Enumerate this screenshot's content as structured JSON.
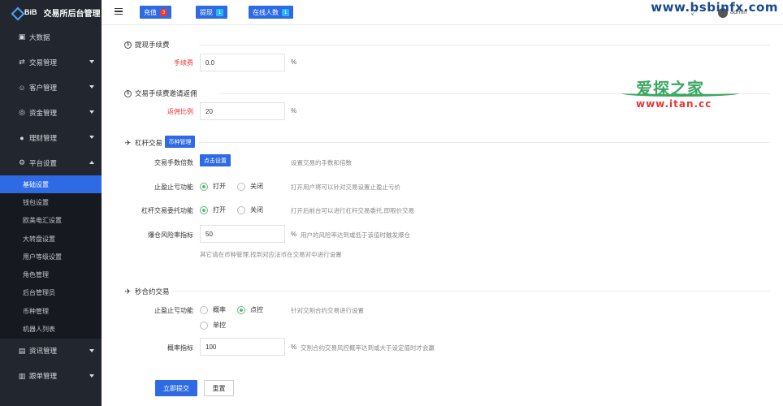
{
  "brand": {
    "logo_text": "BiB",
    "title": "交易所后台管理"
  },
  "sidebar": {
    "items": [
      {
        "label": "大数据",
        "icon": "dashboard-icon",
        "caret": false
      },
      {
        "label": "交易管理",
        "icon": "exchange-icon",
        "caret": true
      },
      {
        "label": "客户管理",
        "icon": "user-icon",
        "caret": true
      },
      {
        "label": "资金管理",
        "icon": "money-icon",
        "caret": true
      },
      {
        "label": "理财管理",
        "icon": "piggy-bank-icon",
        "caret": true
      },
      {
        "label": "平台设置",
        "icon": "gear-icon",
        "caret": true,
        "expanded": true
      }
    ],
    "sub_items": [
      "基础设置",
      "钱包设置",
      "欧美电汇设置",
      "大转盘设置",
      "用户等级设置",
      "角色管理",
      "后台管理员",
      "币种管理",
      "机器人列表"
    ],
    "active_sub": 0,
    "bottom_items": [
      {
        "label": "资讯管理",
        "icon": "news-icon"
      },
      {
        "label": "跟单管理",
        "icon": "copy-trade-icon"
      }
    ]
  },
  "topbar": {
    "recharge": {
      "label": "充值",
      "count": "3"
    },
    "withdraw": {
      "label": "提现",
      "count": "1"
    },
    "online": {
      "label": "在线人数",
      "count": "1"
    },
    "admin_name": "admin",
    "watermark_url": "www.bsbinfx.com"
  },
  "watermark": {
    "cn": "爱探之家",
    "url": "www.itan.cc"
  },
  "sections": {
    "withdraw_fee": {
      "title": "提现手续费",
      "fee_label": "手续费",
      "fee_value": "0.0",
      "unit": "%"
    },
    "rebate": {
      "title": "交易手续费邀请返佣",
      "ratio_label": "返佣比例",
      "ratio_value": "20",
      "unit": "%"
    },
    "leverage": {
      "title": "杠杆交易",
      "coin_button": "币种管理",
      "multiplier_label": "交易手数倍数",
      "multiplier_button": "点击设置",
      "multiplier_hint": "设置交易的手数和倍数",
      "tpsl_label": "止盈止亏功能",
      "tpsl_on": "打开",
      "tpsl_off": "关闭",
      "tpsl_hint": "打开用户将可以针对交易设置止盈止亏价",
      "entrust_label": "杠杆交易委托功能",
      "entrust_on": "打开",
      "entrust_off": "关闭",
      "entrust_hint": "打开后前台可以进行杠杆交易委托,即限价交易",
      "risk_label": "爆仓风险率指标",
      "risk_value": "50",
      "risk_unit": "%",
      "risk_hint": "用户的风险率达到或低于该值时触发爆仓",
      "other_hint": "其它请在币种管理,找到对应法币在交易对中进行设置"
    },
    "seconds": {
      "title": "秒合约交易",
      "tpsl_label": "止盈止亏功能",
      "opt_probability": "概率",
      "opt_point": "点控",
      "opt_single": "单控",
      "tpsl_hint": "针对交割合约交易进行设置",
      "prob_label": "概率指标",
      "prob_value": "100",
      "prob_unit": "%",
      "prob_hint": "交割合约交易风控概率达到或大于设定值时才会赢"
    }
  },
  "actions": {
    "submit": "立即提交",
    "reset": "重置"
  }
}
